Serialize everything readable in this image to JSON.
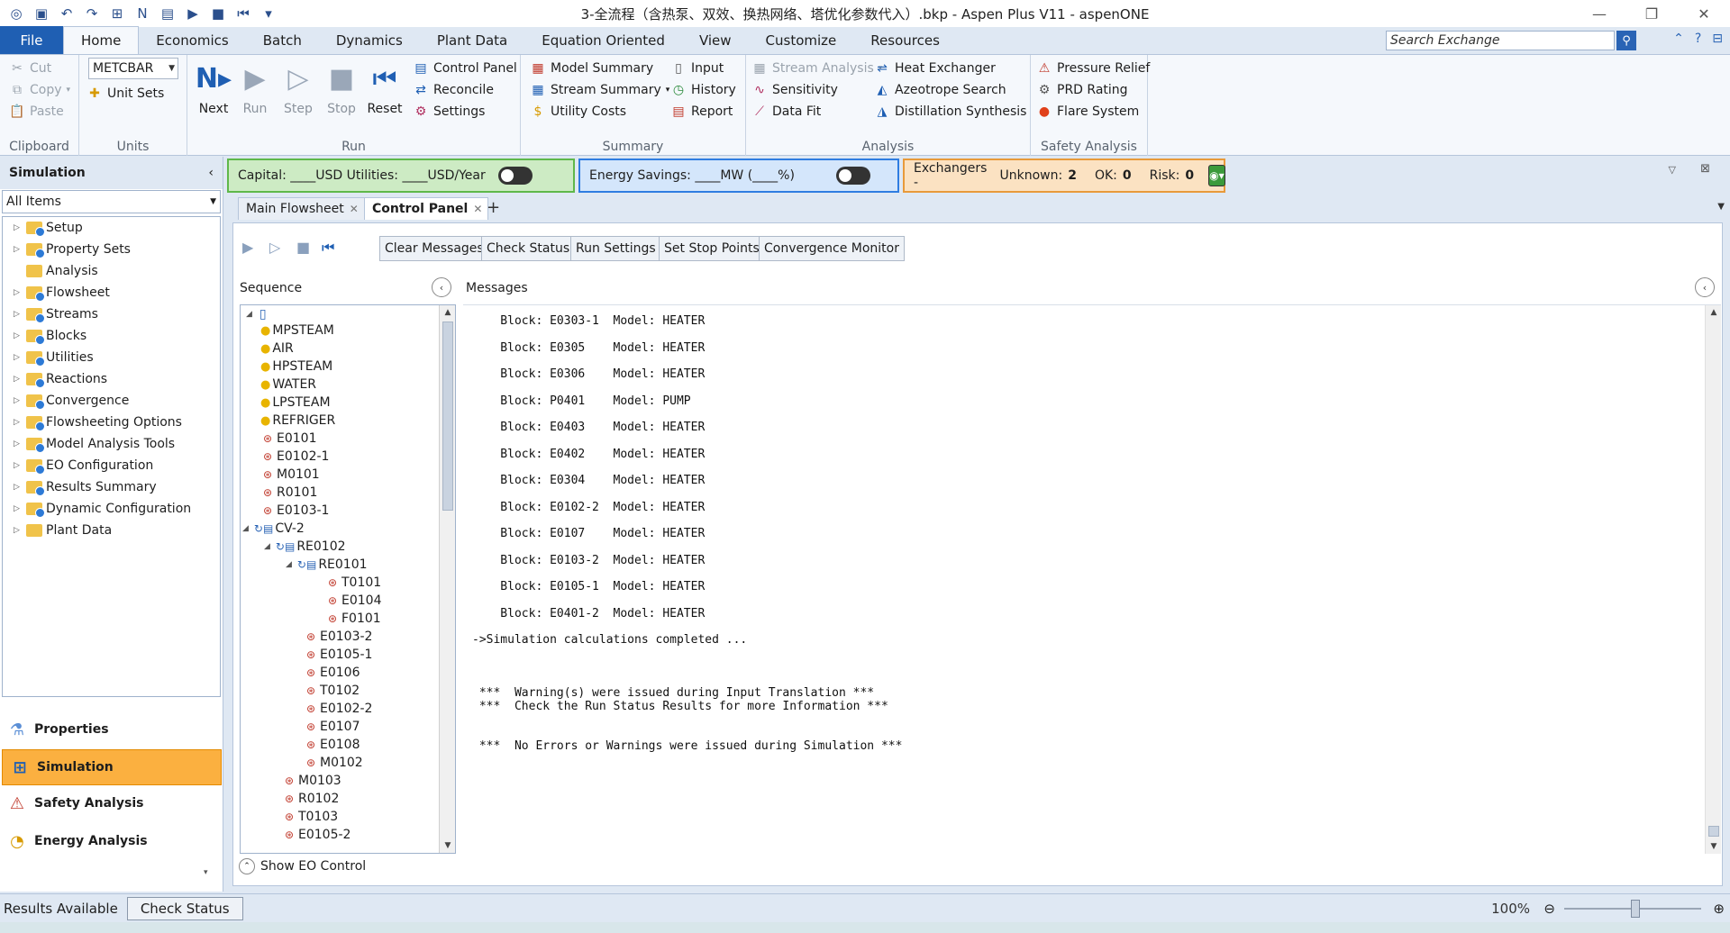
{
  "window": {
    "title": "3-全流程（含热泵、双效、换热网络、塔优化参数代入）.bkp - Aspen Plus V11 - aspenONE"
  },
  "menu": {
    "file": "File",
    "tabs": [
      "Home",
      "Economics",
      "Batch",
      "Dynamics",
      "Plant Data",
      "Equation Oriented",
      "View",
      "Customize",
      "Resources"
    ],
    "active_tab": "Home",
    "search_placeholder": "Search Exchange"
  },
  "ribbon": {
    "clipboard": {
      "label": "Clipboard",
      "cut": "Cut",
      "copy": "Copy",
      "paste": "Paste"
    },
    "units": {
      "label": "Units",
      "unit_set": "METCBAR",
      "unit_sets": "Unit Sets"
    },
    "run": {
      "label": "Run",
      "next": "Next",
      "run": "Run",
      "step": "Step",
      "stop": "Stop",
      "reset": "Reset",
      "control_panel": "Control Panel",
      "reconcile": "Reconcile",
      "settings": "Settings"
    },
    "summary": {
      "label": "Summary",
      "model_summary": "Model Summary",
      "stream_summary": "Stream Summary",
      "utility_costs": "Utility Costs",
      "input": "Input",
      "history": "History",
      "report": "Report"
    },
    "analysis": {
      "label": "Analysis",
      "stream_analysis": "Stream Analysis",
      "sensitivity": "Sensitivity",
      "data_fit": "Data Fit",
      "heat_exchanger": "Heat Exchanger",
      "azeotrope_search": "Azeotrope Search",
      "distillation_synthesis": "Distillation Synthesis"
    },
    "safety": {
      "label": "Safety Analysis",
      "pressure_relief": "Pressure Relief",
      "prd_rating": "PRD Rating",
      "flare_system": "Flare System"
    }
  },
  "nav": {
    "header": "Simulation",
    "filter": "All Items",
    "items": [
      "Setup",
      "Property Sets",
      "Analysis",
      "Flowsheet",
      "Streams",
      "Blocks",
      "Utilities",
      "Reactions",
      "Convergence",
      "Flowsheeting Options",
      "Model Analysis Tools",
      "EO Configuration",
      "Results Summary",
      "Dynamic Configuration",
      "Plant Data"
    ],
    "bottom": [
      "Properties",
      "Simulation",
      "Safety Analysis",
      "Energy Analysis"
    ],
    "bottom_active": "Simulation"
  },
  "panels": {
    "capital": "Capital: ____USD   Utilities: ____USD/Year",
    "energy": "Energy Savings: ____MW    (____%)",
    "exchangers_label": "Exchangers -",
    "unknown_label": "Unknown:",
    "unknown_value": "2",
    "ok_label": "OK:",
    "ok_value": "0",
    "risk_label": "Risk:",
    "risk_value": "0"
  },
  "doc_tabs": [
    "Main Flowsheet",
    "Control Panel"
  ],
  "doc_active": "Control Panel",
  "control_panel": {
    "buttons": [
      "Clear Messages",
      "Check Status",
      "Run Settings",
      "Set Stop Points",
      "Convergence Monitor"
    ],
    "sequence_label": "Sequence",
    "messages_label": "Messages",
    "show_eo": "Show EO Control",
    "sequence": [
      {
        "t": "MPSTEAM",
        "k": "util",
        "d": 1
      },
      {
        "t": "AIR",
        "k": "util",
        "d": 1
      },
      {
        "t": "HPSTEAM",
        "k": "util",
        "d": 1
      },
      {
        "t": "WATER",
        "k": "util",
        "d": 1
      },
      {
        "t": "LPSTEAM",
        "k": "util",
        "d": 1
      },
      {
        "t": "REFRIGER",
        "k": "util",
        "d": 1
      },
      {
        "t": "E0101",
        "k": "block",
        "d": 1
      },
      {
        "t": "E0102-1",
        "k": "block",
        "d": 1
      },
      {
        "t": "M0101",
        "k": "block",
        "d": 1
      },
      {
        "t": "R0101",
        "k": "block",
        "d": 1
      },
      {
        "t": "E0103-1",
        "k": "block",
        "d": 1
      },
      {
        "t": "CV-2",
        "k": "conv",
        "d": 1
      },
      {
        "t": "RE0102",
        "k": "conv",
        "d": 2
      },
      {
        "t": "RE0101",
        "k": "conv",
        "d": 3
      },
      {
        "t": "T0101",
        "k": "block",
        "d": 4
      },
      {
        "t": "E0104",
        "k": "block",
        "d": 4
      },
      {
        "t": "F0101",
        "k": "block",
        "d": 4
      },
      {
        "t": "E0103-2",
        "k": "block",
        "d": 3
      },
      {
        "t": "E0105-1",
        "k": "block",
        "d": 3
      },
      {
        "t": "E0106",
        "k": "block",
        "d": 3
      },
      {
        "t": "T0102",
        "k": "block",
        "d": 3
      },
      {
        "t": "E0102-2",
        "k": "block",
        "d": 3
      },
      {
        "t": "E0107",
        "k": "block",
        "d": 3
      },
      {
        "t": "E0108",
        "k": "block",
        "d": 3
      },
      {
        "t": "M0102",
        "k": "block",
        "d": 3
      },
      {
        "t": "M0103",
        "k": "block",
        "d": 2
      },
      {
        "t": "R0102",
        "k": "block",
        "d": 2
      },
      {
        "t": "T0103",
        "k": "block",
        "d": 2
      },
      {
        "t": "E0105-2",
        "k": "block",
        "d": 2
      }
    ],
    "messages": [
      "    Block: E0303-1  Model: HEATER",
      "    Block: E0305    Model: HEATER",
      "    Block: E0306    Model: HEATER",
      "    Block: P0401    Model: PUMP",
      "    Block: E0403    Model: HEATER",
      "    Block: E0402    Model: HEATER",
      "    Block: E0304    Model: HEATER",
      "    Block: E0102-2  Model: HEATER",
      "    Block: E0107    Model: HEATER",
      "    Block: E0103-2  Model: HEATER",
      "    Block: E0105-1  Model: HEATER",
      "    Block: E0401-2  Model: HEATER",
      "->Simulation calculations completed ...",
      " ***  Warning(s) were issued during Input Translation ***",
      " ***  Check the Run Status Results for more Information ***",
      " ***  No Errors or Warnings were issued during Simulation ***"
    ]
  },
  "statusbar": {
    "results": "Results Available",
    "check_status": "Check Status",
    "zoom": "100%"
  }
}
